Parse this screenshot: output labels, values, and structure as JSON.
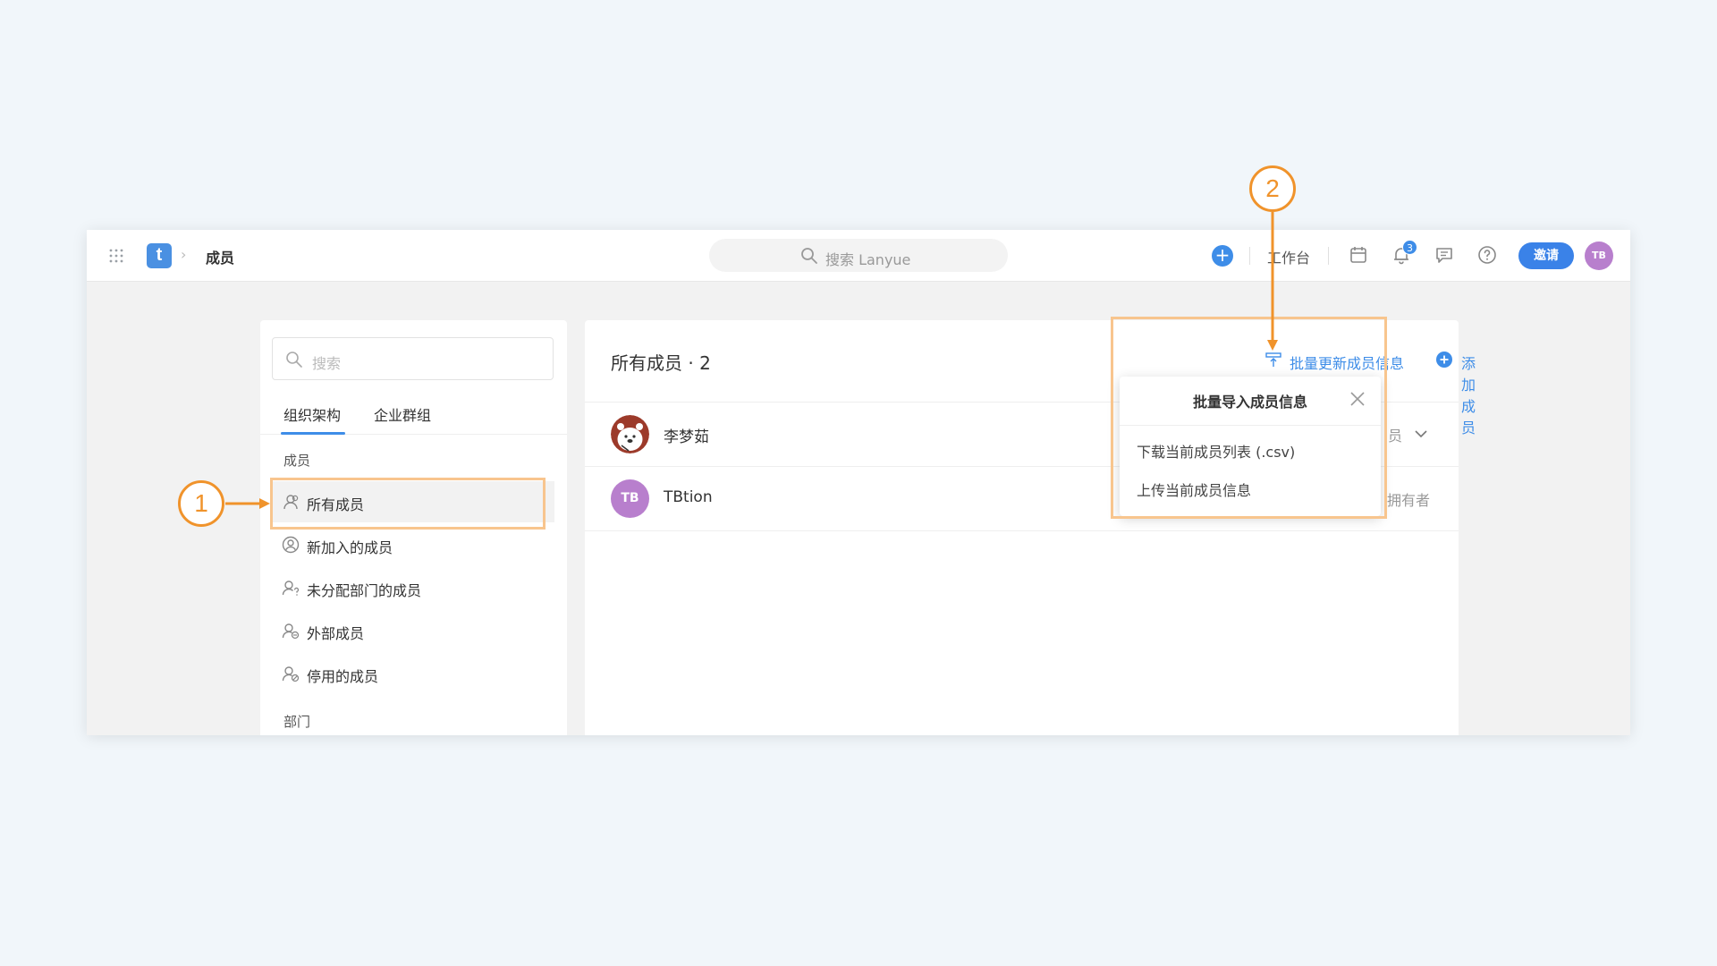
{
  "topbar": {
    "logo_letter": "t",
    "breadcrumb_separator": "›",
    "title": "成员",
    "search_placeholder": "搜索 Lanyue",
    "add_symbol": "+",
    "workbench_label": "工作台",
    "notification_count": "3",
    "invite_label": "邀请",
    "avatar_initials": "TB"
  },
  "sidebar": {
    "search_placeholder": "搜索",
    "tabs": [
      {
        "label": "组织架构",
        "active": true
      },
      {
        "label": "企业群组",
        "active": false
      }
    ],
    "section_members": "成员",
    "items": [
      {
        "label": "所有成员",
        "icon": "user-icon",
        "selected": true
      },
      {
        "label": "新加入的成员",
        "icon": "user-circle-icon"
      },
      {
        "label": "未分配部门的成员",
        "icon": "user-question-icon"
      },
      {
        "label": "外部成员",
        "icon": "user-external-icon"
      },
      {
        "label": "停用的成员",
        "icon": "user-disabled-icon"
      }
    ],
    "section_departments": "部门"
  },
  "main": {
    "title": "所有成员 · 2",
    "batch_update_label": "批量更新成员信息",
    "add_member_label": "添加成员",
    "members": [
      {
        "name": "李梦茹",
        "role": "员",
        "avatar": "bear-avatar"
      },
      {
        "name": "TBtion",
        "role": "拥有者",
        "avatar_initials": "TB"
      }
    ]
  },
  "popup": {
    "title": "批量导入成员信息",
    "items": [
      "下载当前成员列表 (.csv)",
      "上传当前成员信息"
    ]
  },
  "annotations": {
    "marker_1": "1",
    "marker_2": "2"
  },
  "colors": {
    "accent": "#3e8de8",
    "annotation": "#f0932b",
    "highlight": "#f8c58e",
    "avatar_purple": "#b87fcd"
  }
}
